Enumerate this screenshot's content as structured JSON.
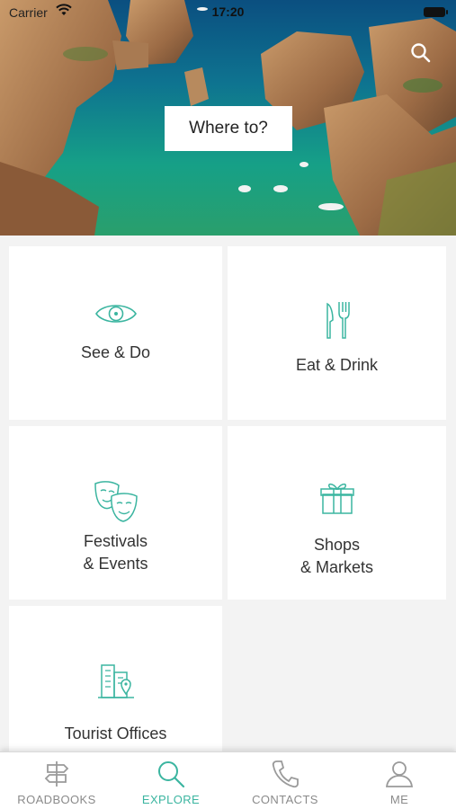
{
  "status_bar": {
    "carrier": "Carrier",
    "time": "17:20"
  },
  "hero": {
    "where_to_label": "Where to?"
  },
  "categories": [
    {
      "label_line1": "See & Do",
      "label_line2": "",
      "icon": "eye-icon"
    },
    {
      "label_line1": "Eat & Drink",
      "label_line2": "",
      "icon": "fork-knife-icon"
    },
    {
      "label_line1": "Festivals",
      "label_line2": "& Events",
      "icon": "theater-masks-icon"
    },
    {
      "label_line1": "Shops",
      "label_line2": "& Markets",
      "icon": "gift-icon"
    },
    {
      "label_line1": "Tourist Offices",
      "label_line2": "",
      "icon": "building-pin-icon"
    }
  ],
  "tabs": [
    {
      "label": "ROADBOOKS",
      "icon": "signpost-icon",
      "active": false
    },
    {
      "label": "EXPLORE",
      "icon": "search-icon",
      "active": true
    },
    {
      "label": "CONTACTS",
      "icon": "phone-icon",
      "active": false
    },
    {
      "label": "ME",
      "icon": "user-icon",
      "active": false
    }
  ],
  "colors": {
    "accent": "#3bb5a0",
    "inactive": "#8a8a8a",
    "tile_bg": "#ffffff",
    "page_bg": "#f3f3f3"
  }
}
